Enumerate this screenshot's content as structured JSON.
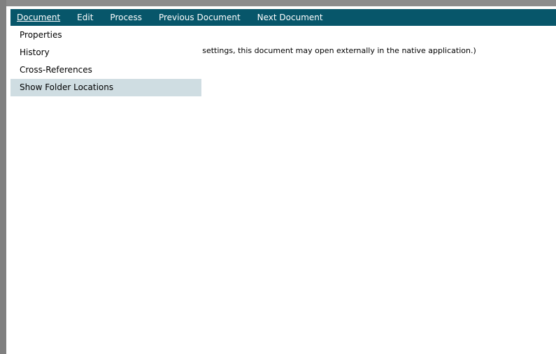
{
  "menubar": {
    "items": [
      {
        "label": "Document",
        "active": true
      },
      {
        "label": "Edit"
      },
      {
        "label": "Process"
      },
      {
        "label": "Previous Document"
      },
      {
        "label": "Next Document"
      }
    ]
  },
  "dropdown": {
    "items": [
      {
        "label": "Properties"
      },
      {
        "label": "History"
      },
      {
        "label": "Cross-References"
      },
      {
        "label": "Show Folder Locations",
        "highlighted": true
      }
    ]
  },
  "content": {
    "message": "m settings, this document may open externally in the native application.)"
  },
  "colors": {
    "menubar_bg": "#07566a",
    "highlight_bg": "#cfdde2",
    "frame_border": "#808080"
  }
}
